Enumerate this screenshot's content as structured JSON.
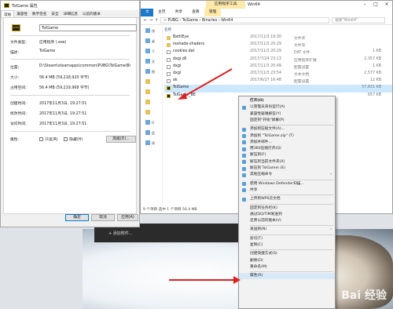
{
  "properties": {
    "title": "TslGame 属性",
    "tabs": [
      "常规",
      "兼容性",
      "数字签名",
      "安全",
      "详细信息",
      "以前的版本"
    ],
    "file_name": "TslGame",
    "labels": {
      "type": "文件类型:",
      "desc": "描述:",
      "location": "位置:",
      "size": "大小:",
      "disk": "占用空间:",
      "created": "创建时间:",
      "modified": "修改时间:",
      "accessed": "访问时间:",
      "attrs": "属性:"
    },
    "values": {
      "type": "应用程序 (.exe)",
      "desc": "TslGame",
      "location": "D:\\Steam\\steamapps\\common\\PUBG\\TslGame\\Bi",
      "size": "56.4 MB (59,218,920 字节)",
      "disk": "56.4 MB (59,219,968 字节)",
      "created": "2017年11月3日, 19:27:51",
      "modified": "2017年11月3日, 19:27:51",
      "accessed": "2017年11月3日, 19:27:51"
    },
    "attr_readonly": "只读(R)",
    "attr_hidden": "隐藏(H)",
    "advanced_button": "高级(D)...",
    "ok": "确定",
    "cancel": "取消",
    "apply": "应用(A)"
  },
  "explorer": {
    "title": "Win64",
    "ribbon_file": "文件",
    "ribbon_tabs": [
      "主页",
      "共享",
      "查看"
    ],
    "app_tools": "应用程序工具",
    "manage": "管理",
    "breadcrumb": "‹‹ PUBG › TslGame › Binaries › Win64",
    "search_placeholder": "搜索\"Win64\"",
    "header": "名称",
    "nav": [
      "快",
      "桌",
      "下",
      "文",
      "图",
      "O",
      "此",
      "网"
    ],
    "files": [
      {
        "name": "BattlEye",
        "date": "2017/11/3 19:30",
        "type": "文件夹",
        "size": ""
      },
      {
        "name": "reshade-shaders",
        "date": "2017/11/3 20:29",
        "type": "文件夹",
        "size": ""
      },
      {
        "name": "cookies.dat",
        "date": "2017/11/3 20:29",
        "type": "DAT 文件",
        "size": "1 KB"
      },
      {
        "name": "dxgi.dll",
        "date": "2017/7/24 23:13",
        "type": "应用程序扩展",
        "size": "2,357 KB"
      },
      {
        "name": "dxgi",
        "date": "2017/11/3 20:49",
        "type": "配置设置",
        "size": "1 KB"
      },
      {
        "name": "dxgi",
        "date": "2017/11/3 23:54",
        "type": "文本文档",
        "size": "2,577 KB"
      },
      {
        "name": "ok",
        "date": "2017/6/27 16:48",
        "type": "配置设置",
        "size": "12 KB"
      },
      {
        "name": "TslGame",
        "date": "",
        "type": "",
        "size": "57,831 KB"
      },
      {
        "name": "TslGame_BE",
        "date": "",
        "type": "",
        "size": "657 KB"
      }
    ],
    "status": "9 个项目    选中 1 个项目 56.4 MB"
  },
  "context_menu": [
    {
      "label": "打开(O)",
      "bold": true
    },
    {
      "label": "以管理员身份运行(A)",
      "icon": true
    },
    {
      "label": "兼容性疑难解答(Y)"
    },
    {
      "label": "固定到\"开始\"屏幕(P)"
    },
    {
      "sep": true
    },
    {
      "label": "添加到压缩文件(A)...",
      "icon": true
    },
    {
      "label": "添加到 \"TslGame.zip\" (T)",
      "icon": true
    },
    {
      "label": "添加并邮件...",
      "icon": true
    },
    {
      "label": "用360压缩打开(Q)",
      "icon": true
    },
    {
      "label": "解压到(F)",
      "icon": true
    },
    {
      "label": "解压到当前文件夹(X)",
      "icon": true
    },
    {
      "label": "解压到 TslGame\\ (E)",
      "icon": true
    },
    {
      "label": "其他压缩命令",
      "icon": true,
      "sub": true
    },
    {
      "sep": true
    },
    {
      "label": "使用 Windows Defender扫描...",
      "icon": true
    },
    {
      "label": "共享",
      "icon": true
    },
    {
      "sep": true
    },
    {
      "label": "上传到WPS云文档",
      "icon": true
    },
    {
      "sep": true
    },
    {
      "label": "固定到任务栏(K)"
    },
    {
      "label": "通过QQ/TIM发送到"
    },
    {
      "label": "还原以前的版本(V)"
    },
    {
      "sep": true
    },
    {
      "label": "发送到(N)",
      "sub": true
    },
    {
      "sep": true
    },
    {
      "label": "剪切(T)"
    },
    {
      "label": "复制(C)"
    },
    {
      "sep": true
    },
    {
      "label": "创建快捷方式(S)"
    },
    {
      "label": "删除(D)"
    },
    {
      "label": "重命名(M)"
    },
    {
      "sep": true
    },
    {
      "label": "属性(R)",
      "hl": true
    }
  ],
  "desktop": {
    "add_text": "+ 添加附件...",
    "watermark": "Bai 经验"
  },
  "colors": {
    "arrow": "#e02020",
    "ribbon_file": "#1979ca",
    "app_tools": "#ffe9a8"
  }
}
